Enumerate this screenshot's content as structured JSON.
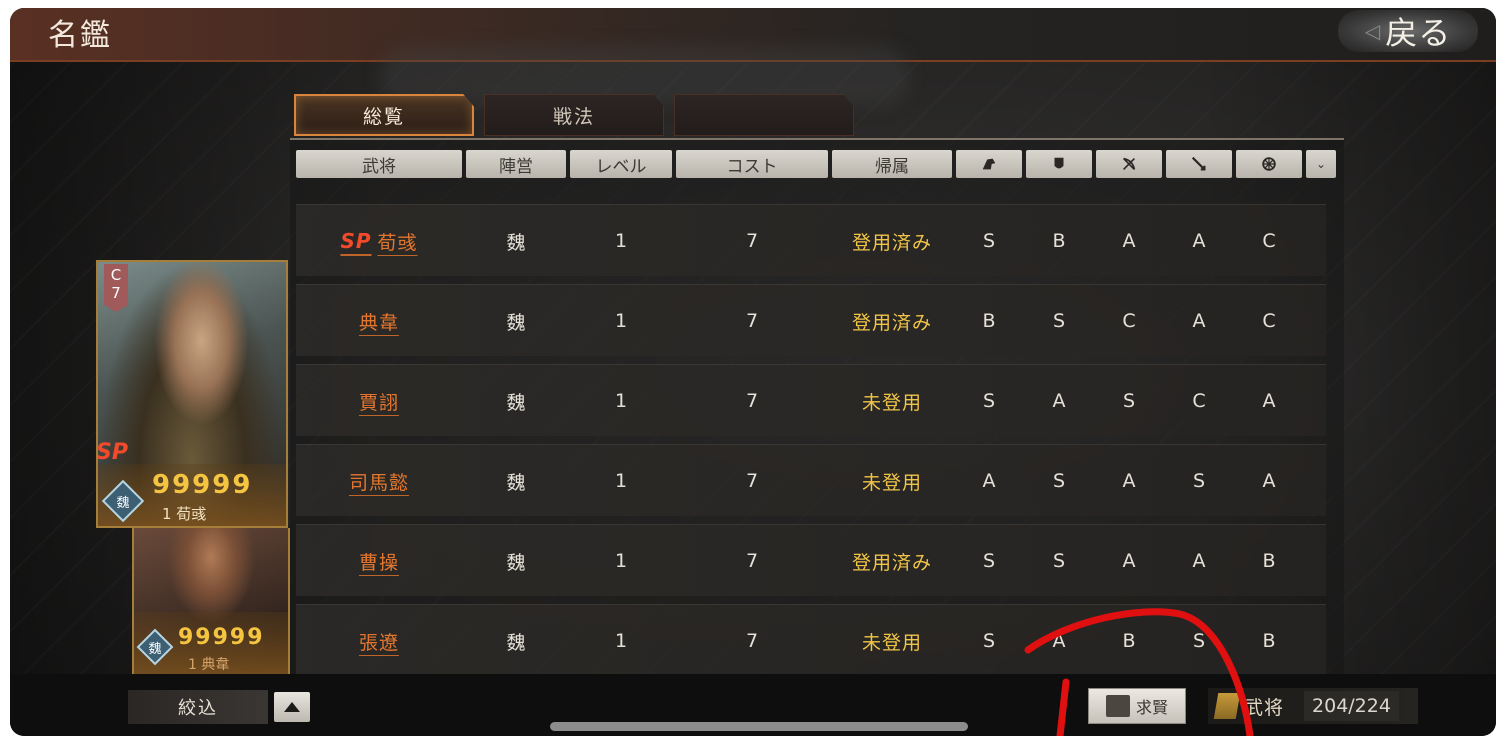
{
  "header": {
    "title": "名鑑",
    "back_label": "戻る"
  },
  "tabs": [
    {
      "label": "総覧",
      "active": true
    },
    {
      "label": "戦法",
      "active": false
    },
    {
      "label": "",
      "active": false
    }
  ],
  "columns": {
    "general": "武将",
    "faction": "陣営",
    "level": "レベル",
    "cost": "コスト",
    "affiliation": "帰属",
    "aptitude_icons": [
      "cavalry-icon",
      "shield-icon",
      "bow-icon",
      "spear-icon",
      "siege-icon"
    ]
  },
  "rows": [
    {
      "sp": "SP",
      "name": "荀彧",
      "faction": "魏",
      "level": "1",
      "cost": "7",
      "status": "登用済み",
      "apt": [
        "S",
        "B",
        "A",
        "A",
        "C"
      ]
    },
    {
      "sp": "",
      "name": "典韋",
      "faction": "魏",
      "level": "1",
      "cost": "7",
      "status": "登用済み",
      "apt": [
        "B",
        "S",
        "C",
        "A",
        "C"
      ]
    },
    {
      "sp": "",
      "name": "賈詡",
      "faction": "魏",
      "level": "1",
      "cost": "7",
      "status": "未登用",
      "apt": [
        "S",
        "A",
        "S",
        "C",
        "A"
      ]
    },
    {
      "sp": "",
      "name": "司馬懿",
      "faction": "魏",
      "level": "1",
      "cost": "7",
      "status": "未登用",
      "apt": [
        "A",
        "S",
        "A",
        "S",
        "A"
      ]
    },
    {
      "sp": "",
      "name": "曹操",
      "faction": "魏",
      "level": "1",
      "cost": "7",
      "status": "登用済み",
      "apt": [
        "S",
        "S",
        "A",
        "A",
        "B"
      ]
    },
    {
      "sp": "",
      "name": "張遼",
      "faction": "魏",
      "level": "1",
      "cost": "7",
      "status": "未登用",
      "apt": [
        "S",
        "A",
        "B",
        "S",
        "B"
      ]
    }
  ],
  "cards": [
    {
      "cost_tag": "C\n7",
      "sp": "SP",
      "faction": "魏",
      "stars": "99999",
      "name": "1 荀彧"
    },
    {
      "faction": "魏",
      "stars": "99999",
      "name": "1 典韋"
    }
  ],
  "bottom": {
    "filter_label": "絞込",
    "recruit_label": "求賢",
    "general_label": "武将",
    "general_count": "204/224"
  },
  "colors": {
    "accent_orange": "#e3762e",
    "status_yellow": "#f0c548",
    "annotation_red": "#e01010"
  }
}
